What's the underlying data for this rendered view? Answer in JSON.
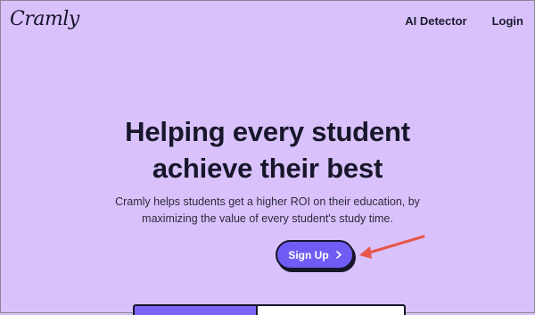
{
  "header": {
    "logo": "Cramly",
    "nav": [
      "AI Detector",
      "Login"
    ]
  },
  "hero": {
    "title_line1": "Helping every student",
    "title_line2": "achieve their best",
    "subtitle_line1": "Cramly helps students get a higher ROI on their education, by",
    "subtitle_line2": "maximizing the value of every student's study time.",
    "cta_label": "Sign Up",
    "cta_icon": "chevron-right-icon"
  },
  "colors": {
    "background": "#d9c2fb",
    "cta": "#6f5cf5",
    "text": "#17162b",
    "annotation_arrow": "#e8564b"
  }
}
